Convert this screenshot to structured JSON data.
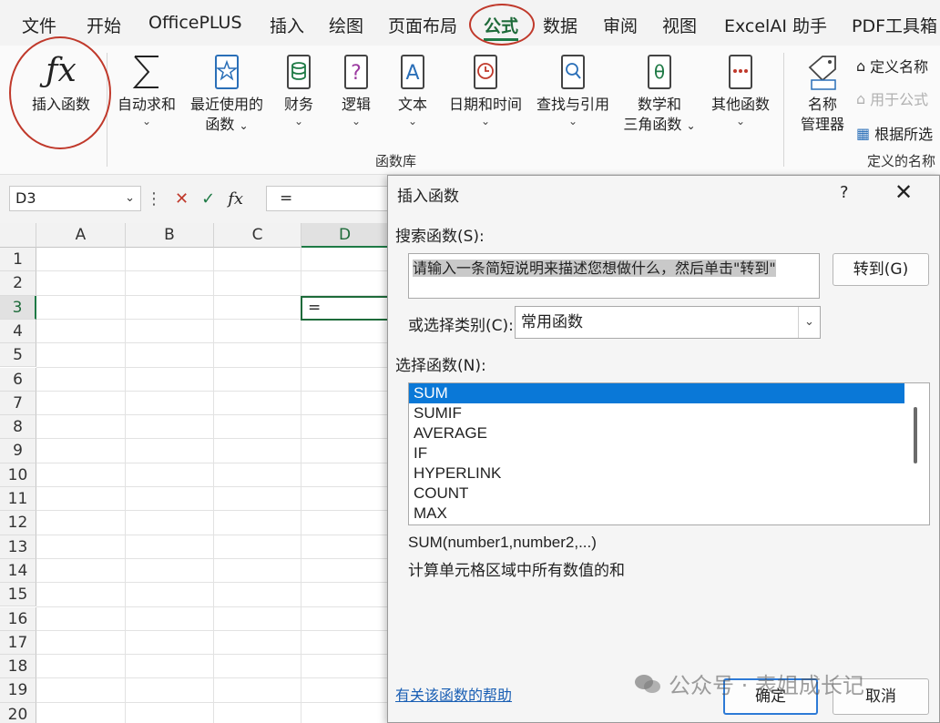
{
  "menu": {
    "items": [
      "文件",
      "开始",
      "OfficePLUS",
      "插入",
      "绘图",
      "页面布局",
      "公式",
      "数据",
      "审阅",
      "视图",
      "ExcelAI 助手",
      "PDF工具箱"
    ],
    "active": "公式"
  },
  "ribbon": {
    "insert_function": "插入函数",
    "autosum": "自动求和",
    "recent_line1": "最近使用的",
    "recent_line2": "函数",
    "financial": "财务",
    "logical": "逻辑",
    "text": "文本",
    "datetime": "日期和时间",
    "lookup": "查找与引用",
    "math_line1": "数学和",
    "math_line2": "三角函数",
    "other": "其他函数",
    "library_label": "函数库",
    "name_manager_line1": "名称",
    "name_manager_line2": "管理器",
    "define_name": "定义名称",
    "use_in_formula": "用于公式",
    "create_from_selection": "根据所选",
    "defined_names_label": "定义的名称"
  },
  "formula_bar": {
    "name_box": "D3",
    "cancel_icon": "✕",
    "enter_icon": "✓",
    "fx": "fx",
    "formula": "="
  },
  "sheet": {
    "columns": [
      "A",
      "B",
      "C",
      "D"
    ],
    "rows": [
      "1",
      "2",
      "3",
      "4",
      "5",
      "6",
      "7",
      "8",
      "9",
      "10",
      "11",
      "12",
      "13",
      "14",
      "15",
      "16",
      "17",
      "18",
      "19",
      "20"
    ],
    "active_cell_value": "="
  },
  "dialog": {
    "title": "插入函数",
    "help": "?",
    "close": "✕",
    "search_label": "搜索函数(S):",
    "search_value": "请输入一条简短说明来描述您想做什么，然后单击\"转到\"",
    "go_button": "转到(G)",
    "category_label": "或选择类别(C):",
    "category_value": "常用函数",
    "function_label": "选择函数(N):",
    "functions": [
      "SUM",
      "SUMIF",
      "AVERAGE",
      "IF",
      "HYPERLINK",
      "COUNT",
      "MAX"
    ],
    "selected_function": "SUM",
    "syntax": "SUM(number1,number2,...)",
    "description": "计算单元格区域中所有数值的和",
    "help_link": "有关该函数的帮助",
    "ok_button": "确定",
    "cancel_button": "取消"
  },
  "watermark": {
    "text": "公众号 · 表姐成长记"
  },
  "colors": {
    "accent_green": "#1e7a45",
    "selection_blue": "#0a78d7",
    "annotation_red": "#c0392b"
  }
}
